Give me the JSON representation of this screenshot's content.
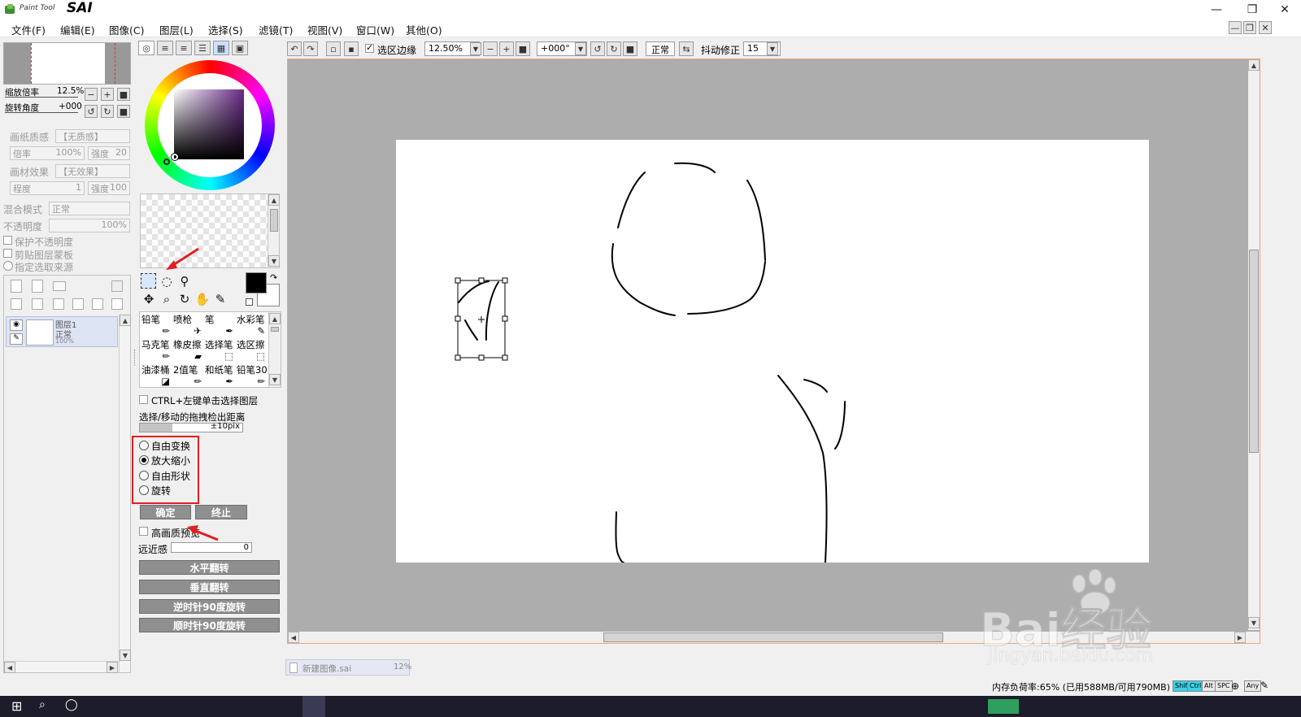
{
  "app": {
    "logo_script": "Paint Tool",
    "logo_name": "SAI"
  },
  "menu": [
    "文件(F)",
    "编辑(E)",
    "图像(C)",
    "图层(L)",
    "选择(S)",
    "滤镜(T)",
    "视图(V)",
    "窗口(W)",
    "其他(O)"
  ],
  "toolbar": {
    "selection_edge_label": "选区边缘",
    "selection_edge_checked": true,
    "zoom_value": "12.50%",
    "rotation_value": "+000°",
    "blend_value": "正常",
    "stabilizer_label": "抖动修正",
    "stabilizer_value": "15"
  },
  "navigator": {
    "zoom_label": "缩放倍率",
    "zoom_value": "12.5%",
    "angle_label": "旋转角度",
    "angle_value": "+000"
  },
  "layer_props": {
    "paper_texture_label": "画纸质感",
    "paper_texture_value": "【无质感】",
    "scale_label": "倍率",
    "scale_value": "100%",
    "strength_label": "强度",
    "strength_value": "20",
    "effect_label": "画材效果",
    "effect_value": "【无效果】",
    "degree_label": "程度",
    "degree_value": "1",
    "strength2_label": "强度",
    "strength2_value": "100",
    "blend_label": "混合模式",
    "blend_value": "正常",
    "opacity_label": "不透明度",
    "opacity_value": "100%",
    "preserve_opacity": "保护不透明度",
    "clip_mask": "剪贴图层蒙板",
    "selection_source": "指定选取来源"
  },
  "layer": {
    "name": "图层1",
    "mode": "正常",
    "opacity": "100%"
  },
  "brushes": [
    [
      "铅笔",
      "喷枪",
      "笔",
      "水彩笔"
    ],
    [
      "马克笔",
      "橡皮擦",
      "选择笔",
      "选区擦"
    ],
    [
      "油漆桶",
      "2值笔",
      "和纸笔",
      "铅笔30"
    ]
  ],
  "transform": {
    "ctrl_select_label": "CTRL+左键单击选择图层",
    "drag_distance_label": "选择/移动的拖拽检出距离",
    "drag_distance_value": "±10pix",
    "options": [
      "自由变换",
      "放大缩小",
      "自由形状",
      "旋转"
    ],
    "selected_option": 1,
    "ok_label": "确定",
    "cancel_label": "终止",
    "hq_preview_label": "高画质预览",
    "perspective_label": "远近感",
    "perspective_value": "0",
    "flip_h": "水平翻转",
    "flip_v": "垂直翻转",
    "rotate_ccw": "逆时针90度旋转",
    "rotate_cw": "顺时针90度旋转"
  },
  "document_tab": {
    "name": "新建图像.sai",
    "zoom": "12%"
  },
  "status": {
    "memory": "内存负荷率:65% (已用588MB/可用790MB)",
    "keys": [
      "Shift",
      "Ctrl",
      "Alt",
      "SPC",
      "Any"
    ]
  },
  "watermark": {
    "text": "Bai经验",
    "url": "jingyan.baidu.com"
  },
  "colors": {
    "highlight_red": "#e02020",
    "canvas_gray": "#adadad",
    "paper": "#ffffff",
    "primary_color": "#000000",
    "secondary_color": "#ffffff"
  }
}
